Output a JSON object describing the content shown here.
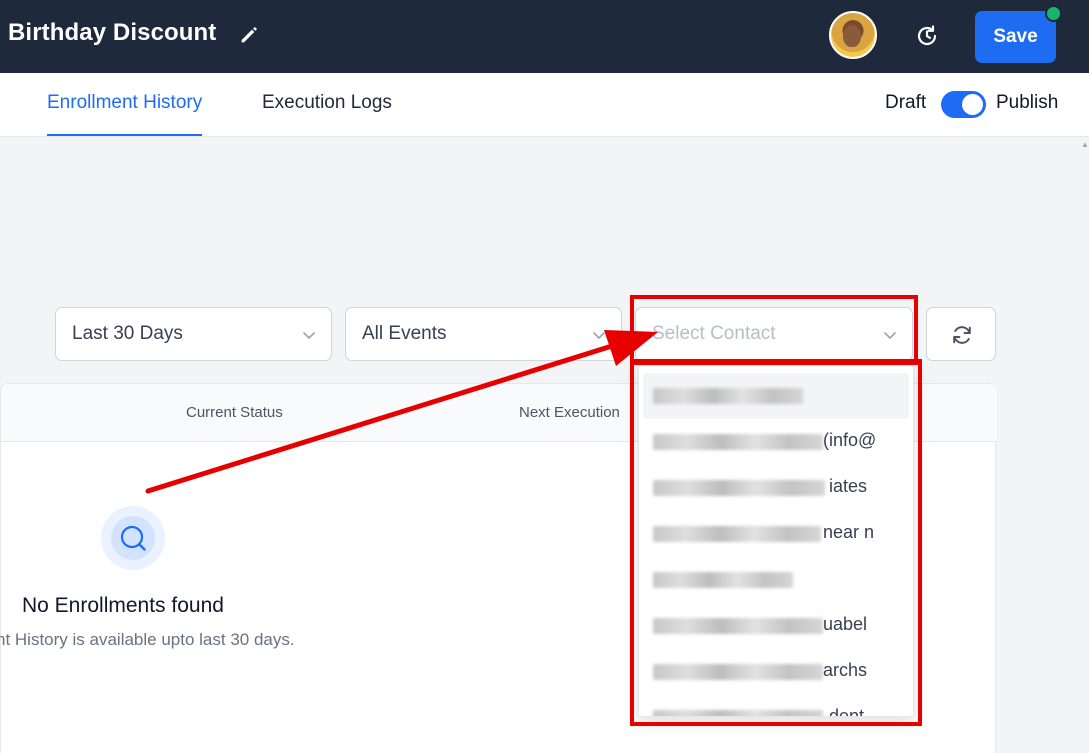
{
  "header": {
    "title": "Birthday Discount",
    "save_label": "Save"
  },
  "tabs": [
    {
      "label": "Enrollment History",
      "active": true
    },
    {
      "label": "Execution Logs",
      "active": false
    }
  ],
  "status_toggle": {
    "left_label": "Draft",
    "right_label": "Publish",
    "state": "Publish"
  },
  "filters": {
    "date_range": "Last 30 Days",
    "events": "All Events",
    "contact_placeholder": "Select Contact"
  },
  "table": {
    "columns": [
      "Current Status",
      "Next Execution"
    ]
  },
  "empty_state": {
    "title": "No Enrollments found",
    "subtitle": "nt History is available upto last 30 days."
  },
  "contact_dropdown": {
    "items": [
      {
        "visible_text": ""
      },
      {
        "visible_text": "(info@"
      },
      {
        "visible_text": "iates"
      },
      {
        "visible_text": "near n"
      },
      {
        "visible_text": ""
      },
      {
        "visible_text": "uabel"
      },
      {
        "visible_text": "archs"
      },
      {
        "visible_text": "dent"
      }
    ]
  },
  "colors": {
    "header_bg": "#1e293b",
    "accent": "#1d6cf2",
    "online_dot": "#12b76a",
    "annotation": "#e60000"
  },
  "icons": {
    "edit": "pencil-icon",
    "history": "clock-history-icon",
    "refresh": "refresh-icon",
    "chevron": "chevron-down-icon",
    "empty": "search-icon"
  }
}
